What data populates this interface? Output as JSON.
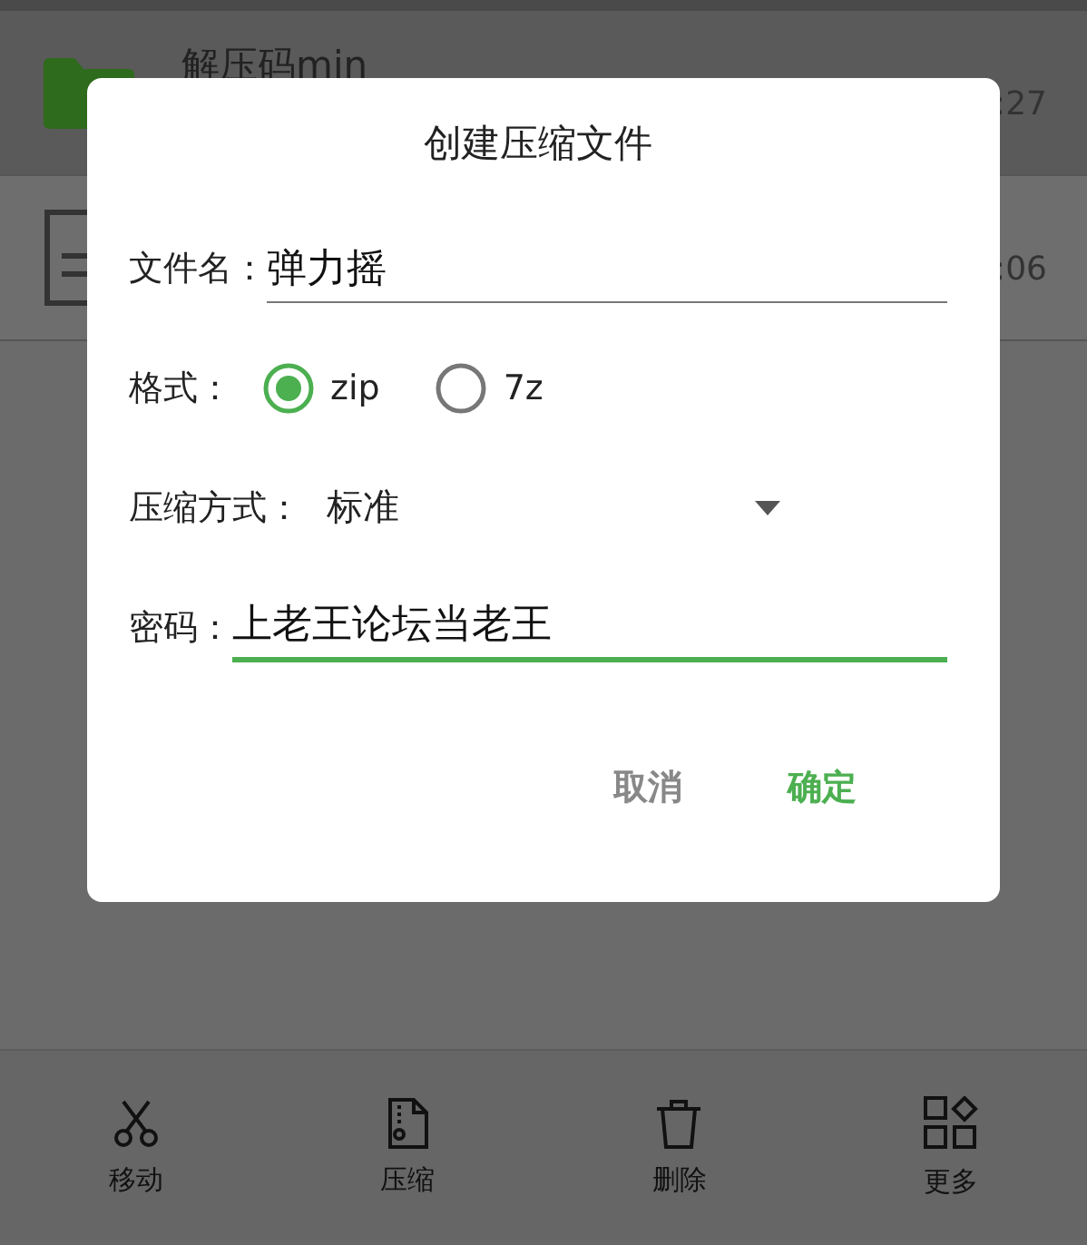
{
  "files": [
    {
      "kind": "folder",
      "name": "解压码min",
      "time": ":27"
    },
    {
      "kind": "document",
      "time": ":06"
    }
  ],
  "dialog": {
    "title": "创建压缩文件",
    "filename": {
      "label": "文件名：",
      "value": "弹力摇"
    },
    "format": {
      "label": "格式：",
      "options": [
        {
          "label": "zip",
          "selected": true
        },
        {
          "label": "7z",
          "selected": false
        }
      ]
    },
    "method": {
      "label": "压缩方式：",
      "value": "标准"
    },
    "password": {
      "label": "密码：",
      "value": "上老王论坛当老王"
    },
    "buttons": [
      {
        "label": "取消",
        "kind": "cancel"
      },
      {
        "label": "确定",
        "kind": "confirm"
      }
    ]
  },
  "toolbar": [
    {
      "kind": "scissors",
      "label": "移动"
    },
    {
      "kind": "zip",
      "label": "压缩"
    },
    {
      "kind": "trash",
      "label": "删除"
    },
    {
      "kind": "grid",
      "label": "更多"
    }
  ]
}
